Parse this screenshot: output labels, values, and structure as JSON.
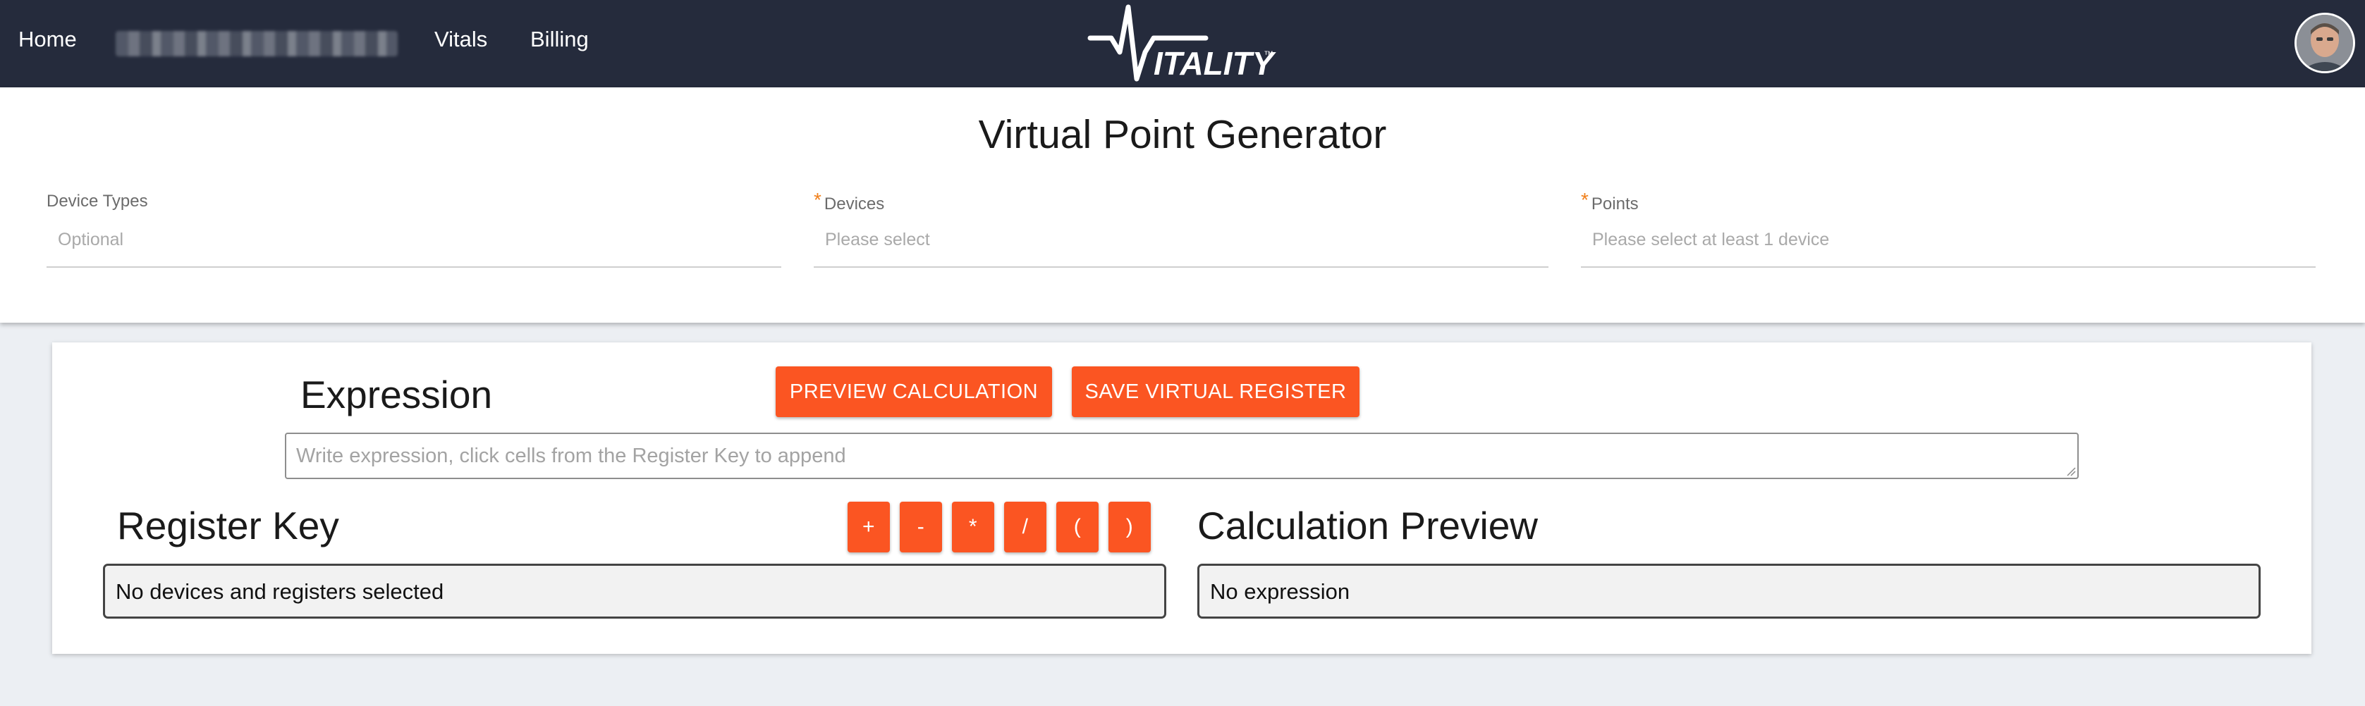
{
  "nav": {
    "links": [
      "Home",
      "Vitals",
      "Billing"
    ],
    "logo_text": "ITALITY",
    "logo_mark": "™"
  },
  "page": {
    "title": "Virtual Point Generator"
  },
  "filters": {
    "device_types": {
      "label": "Device Types",
      "placeholder": "Optional",
      "required": false
    },
    "devices": {
      "label": "Devices",
      "placeholder": "Please select",
      "required": true
    },
    "points": {
      "label": "Points",
      "placeholder": "Please select at least 1 device",
      "required": true
    },
    "required_mark": "*"
  },
  "expression": {
    "heading": "Expression",
    "placeholder": "Write expression, click cells from the Register Key to append",
    "preview_button": "PREVIEW CALCULATION",
    "save_button": "SAVE VIRTUAL REGISTER"
  },
  "register_key": {
    "heading": "Register Key",
    "operators": [
      "+",
      "-",
      "*",
      "/",
      "(",
      ")"
    ],
    "empty_text": "No devices and registers selected"
  },
  "calculation_preview": {
    "heading": "Calculation Preview",
    "empty_text": "No expression"
  },
  "colors": {
    "nav_bg": "#252b3c",
    "accent": "#fb5522",
    "required": "#f07f1a",
    "page_bg": "#eceff3"
  }
}
